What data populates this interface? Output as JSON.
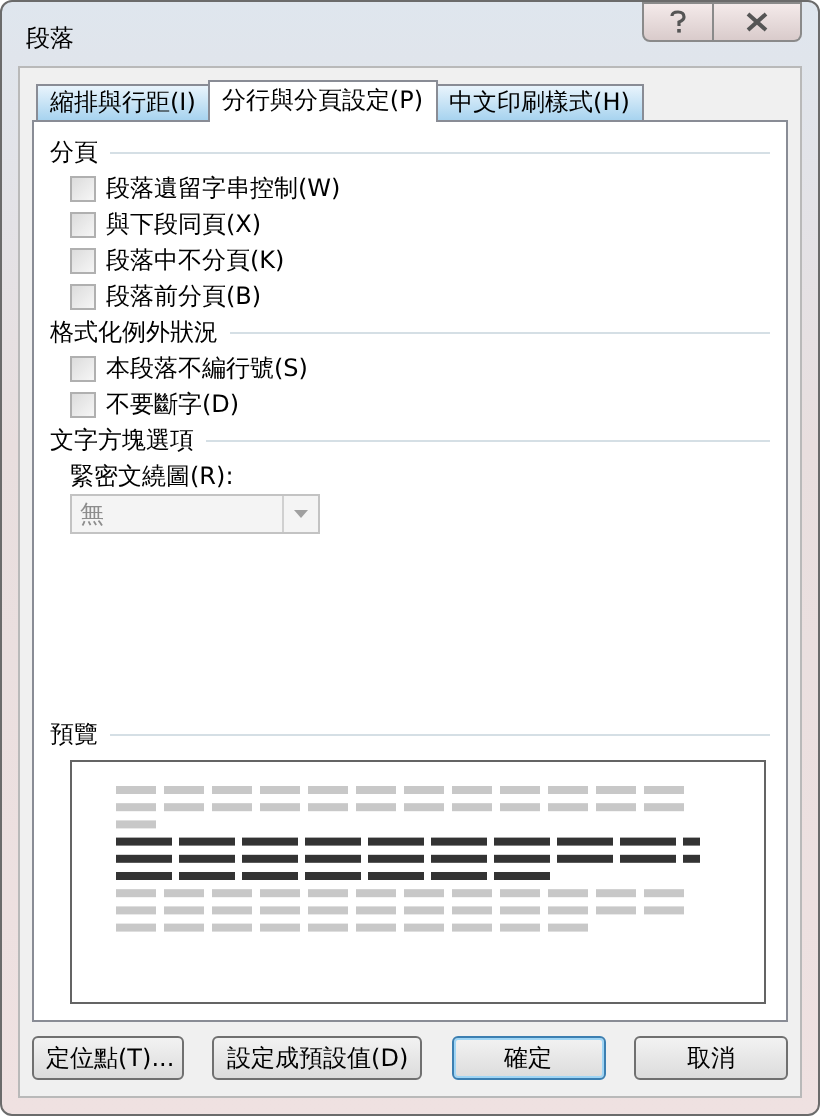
{
  "window": {
    "title": "段落"
  },
  "tabs": [
    {
      "label": "縮排與行距(I)",
      "selected": false
    },
    {
      "label": "分行與分頁設定(P)",
      "selected": true
    },
    {
      "label": "中文印刷樣式(H)",
      "selected": false
    }
  ],
  "sections": [
    {
      "title": "分頁",
      "options": [
        {
          "label": "段落遺留字串控制(W)",
          "checked": false
        },
        {
          "label": "與下段同頁(X)",
          "checked": false
        },
        {
          "label": "段落中不分頁(K)",
          "checked": false
        },
        {
          "label": "段落前分頁(B)",
          "checked": false
        }
      ]
    },
    {
      "title": "格式化例外狀況",
      "options": [
        {
          "label": "本段落不編行號(S)",
          "checked": false
        },
        {
          "label": "不要斷字(D)",
          "checked": false
        }
      ]
    },
    {
      "title": "文字方塊選項",
      "dropdown": {
        "label": "緊密文繞圖(R):",
        "value": "無",
        "disabled": true
      }
    }
  ],
  "preview": {
    "title": "預覽"
  },
  "buttons": [
    {
      "label": "定位點(T)...",
      "default": false
    },
    {
      "label": "設定成預設值(D)",
      "default": false
    },
    {
      "label": "確定",
      "default": true
    },
    {
      "label": "取消",
      "default": false
    }
  ]
}
